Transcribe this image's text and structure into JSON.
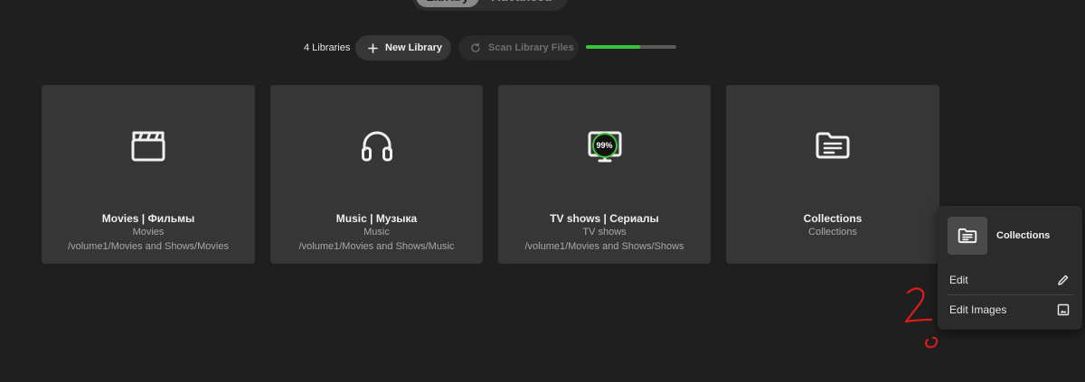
{
  "tabs": [
    {
      "label": "Library"
    },
    {
      "label": "Advanced"
    }
  ],
  "toolbar": {
    "library_count": "4 Libraries",
    "new_library_label": "New Library",
    "scan_label": "Scan Library Files",
    "scan_progress_fraction": 0.6
  },
  "libraries": [
    {
      "title": "Movies | Фильмы",
      "type": "Movies",
      "path": "/volume1/Movies and Shows/Movies",
      "icon": "clapperboard-icon"
    },
    {
      "title": "Music | Музыка",
      "type": "Music",
      "path": "/volume1/Movies and Shows/Music",
      "icon": "headphones-icon"
    },
    {
      "title": "TV shows | Сериалы",
      "type": "TV shows",
      "path": "/volume1/Movies and Shows/Shows",
      "icon": "tv-icon",
      "progress_badge": "99%"
    },
    {
      "title": "Collections",
      "type": "Collections",
      "icon": "collection-folder-icon"
    }
  ],
  "context_menu": {
    "title": "Collections",
    "items": [
      {
        "label": "Edit",
        "icon": "pencil-icon"
      },
      {
        "label": "Edit Images",
        "icon": "image-icon"
      }
    ]
  },
  "colors": {
    "background": "#1f1f1f",
    "card": "#363636",
    "accent_progress": "#35c43a",
    "annotation": "#e01b1b"
  }
}
